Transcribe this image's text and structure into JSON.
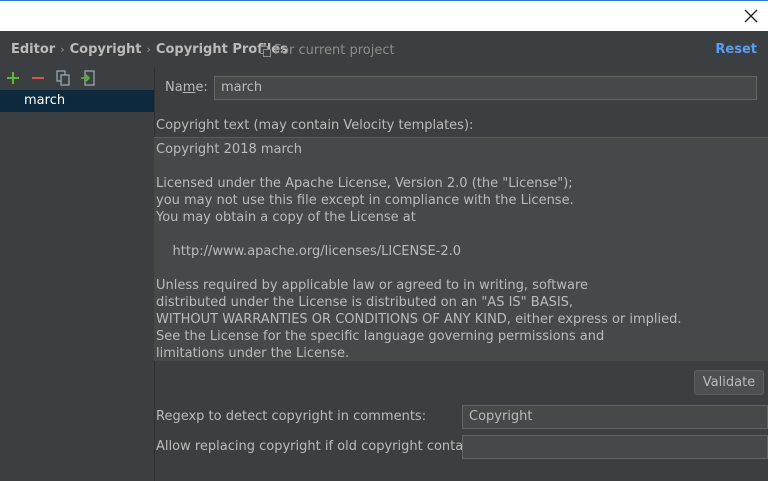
{
  "header": {
    "breadcrumbs": [
      "Editor",
      "Copyright",
      "Copyright Profiles"
    ],
    "scope_label": "For current project",
    "reset_label": "Reset"
  },
  "left_panel": {
    "profiles": [
      "march"
    ]
  },
  "form": {
    "name_label_pre": "Na",
    "name_label_mn": "m",
    "name_label_post": "e:",
    "name_value": "march",
    "copyright_text_label": "Copyright text (may contain Velocity templates):",
    "copyright_text": "Copyright 2018 march\n\nLicensed under the Apache License, Version 2.0 (the \"License\");\nyou may not use this file except in compliance with the License.\nYou may obtain a copy of the License at\n\n    http://www.apache.org/licenses/LICENSE-2.0\n\nUnless required by applicable law or agreed to in writing, software\ndistributed under the License is distributed on an \"AS IS\" BASIS,\nWITHOUT WARRANTIES OR CONDITIONS OF ANY KIND, either express or implied.\nSee the License for the specific language governing permissions and\nlimitations under the License.",
    "validate_label": "Validate",
    "regexp_label": "Regexp to detect copyright in comments:",
    "regexp_value": "Copyright",
    "allow_replacing_label": "Allow replacing copyright if old copyright contains:",
    "allow_replacing_value": ""
  },
  "colors": {
    "background": "#3c3f41",
    "accent_link": "#589df6",
    "selection": "#0d293e",
    "add_icon": "#5fb832",
    "remove_icon": "#d9534f"
  }
}
